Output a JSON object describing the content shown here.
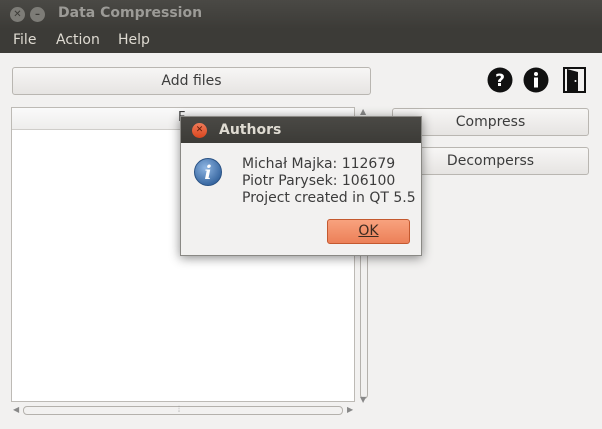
{
  "window": {
    "title": "Data Compression",
    "close_glyph": "✕",
    "min_glyph": "–"
  },
  "menu": {
    "items": [
      "File",
      "Action",
      "Help"
    ]
  },
  "toolbar": {
    "add_files_label": "Add files",
    "help_icon": "question-circle-icon",
    "about_icon": "info-circle-icon",
    "exit_icon": "door-exit-icon"
  },
  "list": {
    "header_text": "F"
  },
  "actions": {
    "compress_label": "Compress",
    "decompress_label": "Decomperss"
  },
  "scrollbar": {
    "up_arrow": "▲",
    "down_arrow": "▼",
    "left_arrow": "◀",
    "right_arrow": "▶",
    "grip": "⦙"
  },
  "dialog": {
    "title": "Authors",
    "close_glyph": "✕",
    "icon": "info-icon",
    "lines": [
      "Michał Majka: 112679",
      "Piotr Parysek: 106100",
      "Project created in QT 5.5"
    ],
    "ok_label": "OK"
  },
  "colors": {
    "titlebar": "#3c3b37",
    "accent_orange": "#ec8058",
    "info_blue": "#3a6ea8"
  }
}
